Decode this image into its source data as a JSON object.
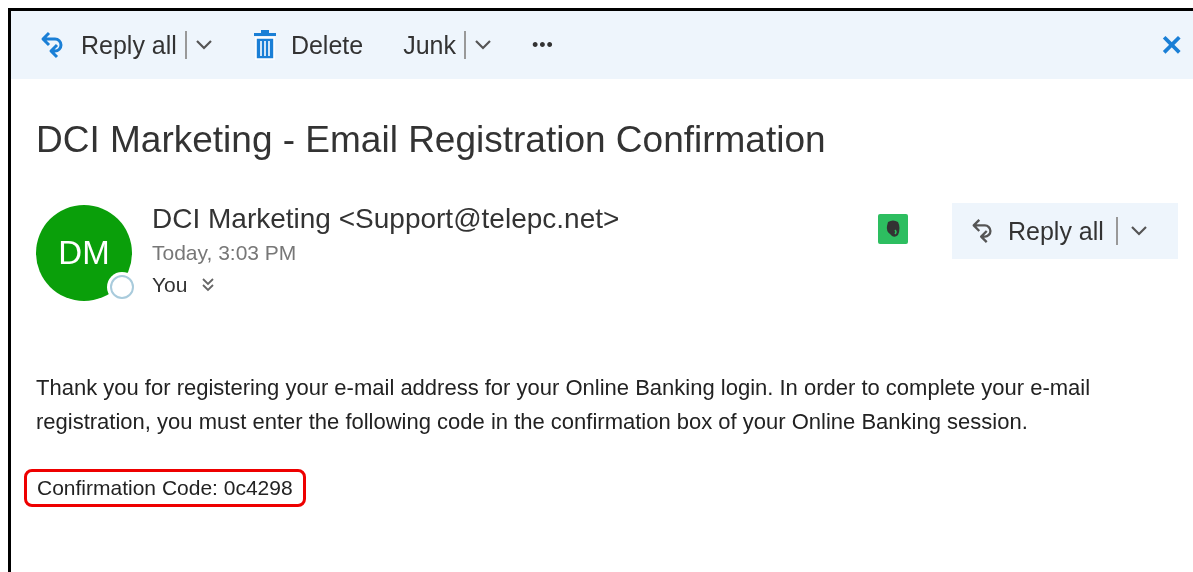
{
  "toolbar": {
    "items": [
      {
        "kind": "reply",
        "label": "Reply all",
        "dropdown": true
      },
      {
        "kind": "delete",
        "label": "Delete",
        "dropdown": false
      },
      {
        "kind": "plain",
        "label": "Junk",
        "dropdown": true
      },
      {
        "kind": "more",
        "label": "•••"
      }
    ],
    "close": "✕"
  },
  "message": {
    "subject": "DCI Marketing - Email Registration Confirmation",
    "sender": {
      "initials": "DM",
      "name": "DCI Marketing <Support@telepc.net>",
      "time": "Today, 3:03 PM",
      "to": "You"
    },
    "reply_button": {
      "label": "Reply all"
    },
    "body": [
      "Thank you for registering your e-mail address for your Online Banking login.  In order to complete your e-mail registration, you must enter the following code in the confirmation box of your Online Banking session."
    ],
    "code_line": {
      "text": "Confirmation Code: 0c4298",
      "highlighted": true
    }
  }
}
